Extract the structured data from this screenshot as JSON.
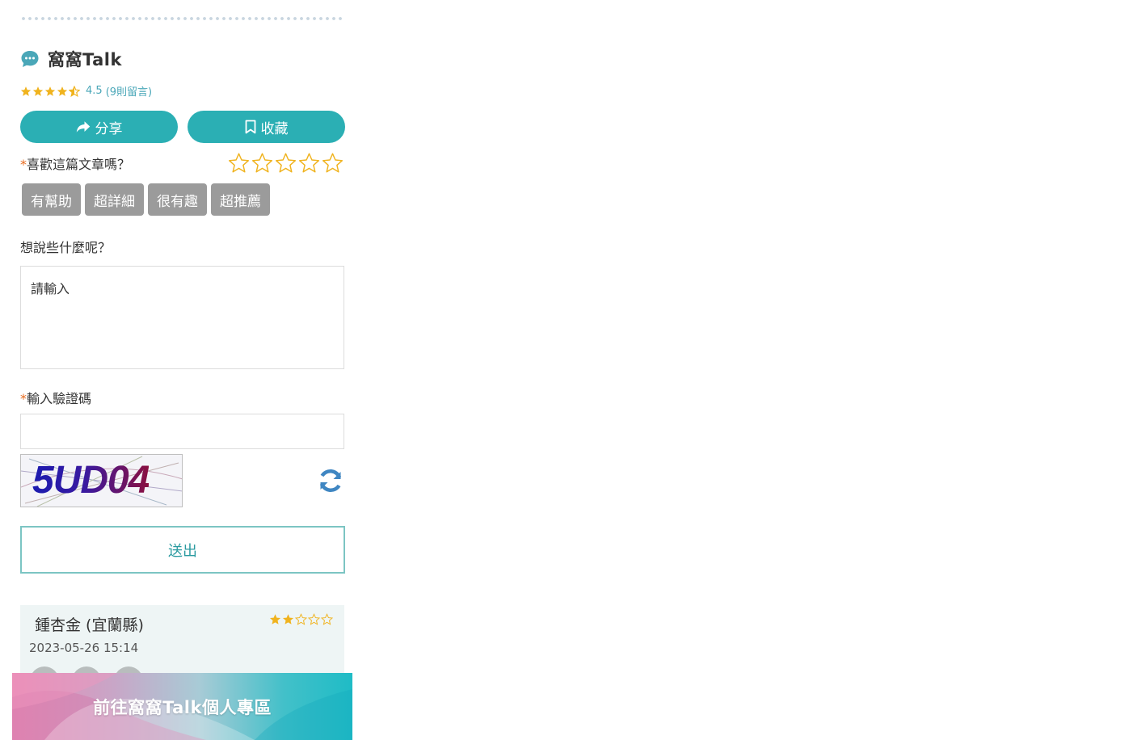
{
  "section": {
    "title": "窩窩Talk",
    "rating": {
      "score": "4.5",
      "count_text": "(9則留言)",
      "stars": 4.5
    }
  },
  "actions": {
    "share_label": "分享",
    "save_label": "收藏"
  },
  "feedback": {
    "required_mark": "*",
    "like_question": "喜歡這篇文章嗎？",
    "tags": [
      "有幫助",
      "超詳細",
      "很有趣",
      "超推薦"
    ],
    "say_label": "想說些什麼呢？",
    "comment_placeholder": "請輸入",
    "captcha_label": "輸入驗證碼",
    "captcha_text": "5UD04",
    "submit_label": "送出"
  },
  "review": {
    "name": "鍾杏金 (宜蘭縣)",
    "date": "2023-05-26 15:14",
    "stars": 2
  },
  "banner": {
    "label": "前往窩窩Talk個人專區"
  },
  "colors": {
    "teal": "#2bafb4",
    "star": "#f0b31e",
    "tag_gray": "#9b9b9b",
    "required": "#e86b1f"
  }
}
